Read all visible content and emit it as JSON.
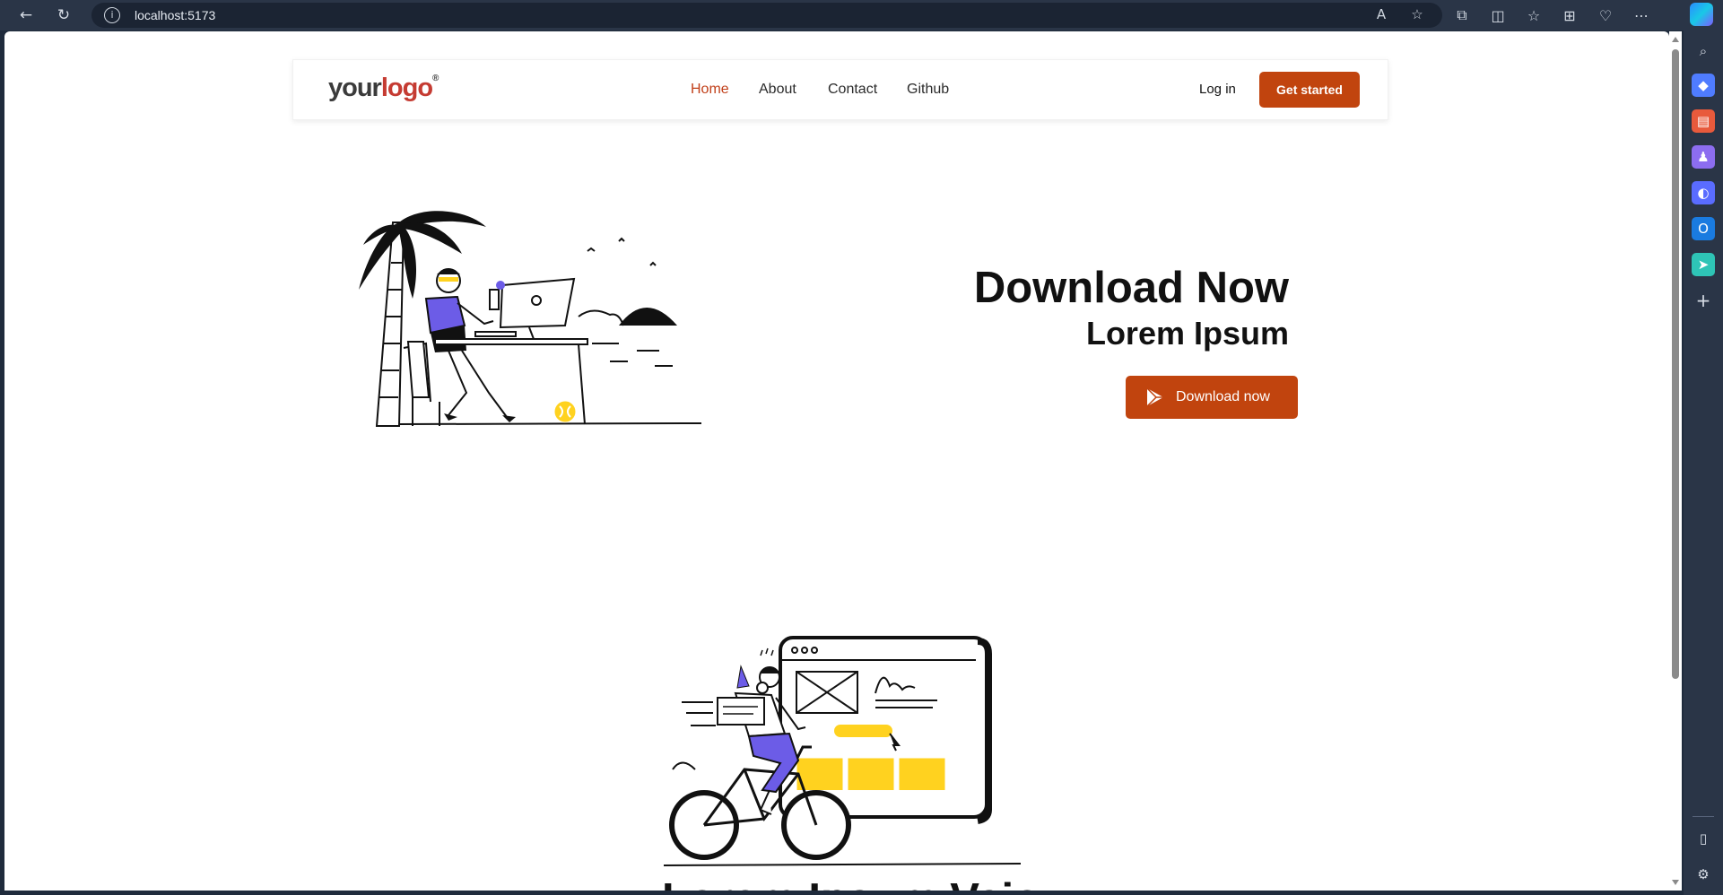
{
  "browser": {
    "url": "localhost:5173",
    "nav_icons": [
      "back-icon",
      "refresh-icon"
    ],
    "address_icons": [
      "read-aloud-icon",
      "favorite-star-icon"
    ],
    "toolbar_icons": [
      "extensions-icon",
      "split-screen-icon",
      "favorites-icon",
      "collections-icon",
      "performance-icon",
      "more-icon",
      "copilot-icon"
    ],
    "sidebar_icons": [
      "search-icon",
      "shopping-tag-icon",
      "toolbox-icon",
      "games-icon",
      "copilot-sidebar-icon",
      "outlook-icon",
      "send-icon",
      "add-icon",
      "sidebar-layout-icon",
      "settings-icon"
    ]
  },
  "header": {
    "logo_your": "your",
    "logo_word": "logo",
    "logo_reg": "®",
    "nav": [
      "Home",
      "About",
      "Contact",
      "Github"
    ],
    "active_nav": "Home",
    "login_label": "Log in",
    "cta_label": "Get started"
  },
  "hero": {
    "title": "Download Now",
    "subtitle": "Lorem Ipsum",
    "button_label": "Download now"
  },
  "section2": {
    "title": "Lorem Ipsum Vaio"
  },
  "colors": {
    "accent": "#c1440e",
    "nav_active": "#c1401a",
    "logo_red": "#c53b32",
    "illustration_purple": "#6c5ce7",
    "illustration_yellow": "#ffd21f"
  }
}
